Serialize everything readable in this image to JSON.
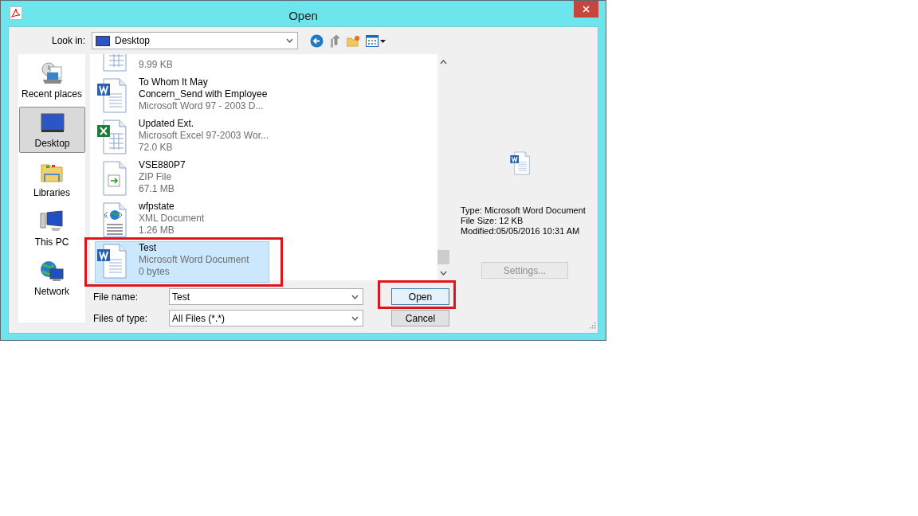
{
  "window": {
    "title": "Open"
  },
  "look_in": {
    "label": "Look in:",
    "value": "Desktop"
  },
  "places": [
    {
      "kind": "recent",
      "label": "Recent places",
      "selected": false
    },
    {
      "kind": "desktop",
      "label": "Desktop",
      "selected": true
    },
    {
      "kind": "libraries",
      "label": "Libraries",
      "selected": false
    },
    {
      "kind": "pc",
      "label": "This PC",
      "selected": false
    },
    {
      "kind": "network",
      "label": "Network",
      "selected": false
    }
  ],
  "files": [
    {
      "kind": "excel",
      "size": "9.99 KB",
      "selected": false,
      "highlighted": false
    },
    {
      "kind": "word",
      "name": "To Whom It May\nConcern_Send with Employee",
      "type": "Microsoft Word 97 - 2003 D...",
      "selected": false,
      "highlighted": false
    },
    {
      "kind": "excel",
      "name": "Updated Ext.",
      "type": "Microsoft Excel 97-2003 Wor...",
      "size": "72.0 KB",
      "selected": false,
      "highlighted": false
    },
    {
      "kind": "zip",
      "name": "VSE880P7",
      "type": "ZIP File",
      "size": "67.1 MB",
      "selected": false,
      "highlighted": false
    },
    {
      "kind": "xml",
      "name": "wfpstate",
      "type": "XML Document",
      "size": "1.26 MB",
      "selected": false,
      "highlighted": false
    },
    {
      "kind": "word",
      "name": "Test",
      "type": "Microsoft Word Document",
      "size": "0 bytes",
      "selected": true,
      "highlighted": true
    }
  ],
  "preview": {
    "kind": "word",
    "lines": [
      "Type: Microsoft Word Document",
      "File Size: 12 KB",
      "Modified:05/05/2016 10:31 AM"
    ],
    "settings_button": {
      "label": "Settings...",
      "disabled": true
    }
  },
  "file_name": {
    "label": "File name:",
    "value": "Test"
  },
  "file_type": {
    "label": "Files of type:",
    "value": "All Files (*.*)"
  },
  "buttons": [
    {
      "label": "Open",
      "default": true,
      "highlighted": true
    },
    {
      "label": "Cancel",
      "default": false,
      "highlighted": false
    }
  ]
}
